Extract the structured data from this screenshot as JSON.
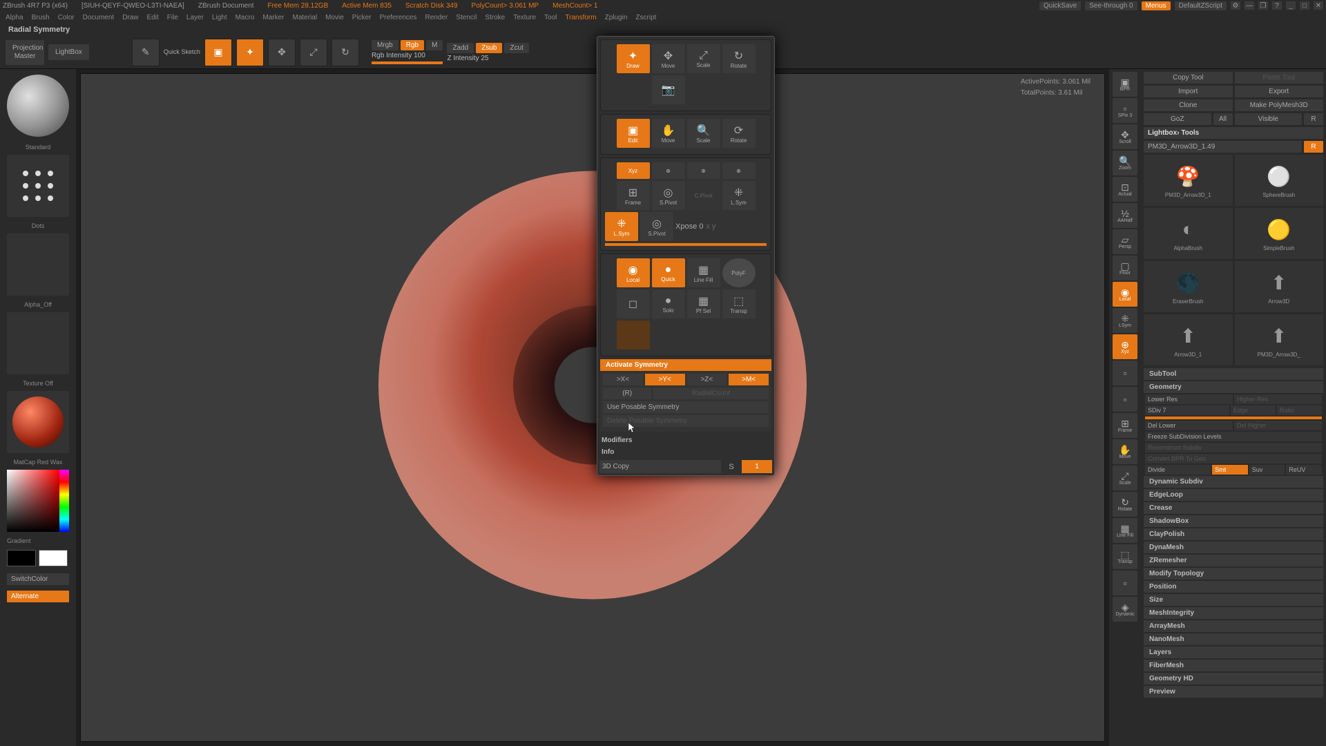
{
  "titlebar": {
    "app": "ZBrush 4R7 P3 (x64)",
    "session": "[SIUH-QEYF-QWEO-L3TI-NAEA]",
    "doc": "ZBrush Document",
    "free_mem": "Free Mem 28.12GB",
    "active_mem": "Active Mem 835",
    "scratch_disk": "Scratch Disk 349",
    "poly_count": "PolyCount> 3.061 MP",
    "mesh_count": "MeshCount> 1",
    "quicksave": "QuickSave",
    "see_through": "See-through 0",
    "menus": "Menus",
    "zscript": "DefaultZScript"
  },
  "menubar": {
    "items": [
      "Alpha",
      "Brush",
      "Color",
      "Document",
      "Draw",
      "Edit",
      "File",
      "Layer",
      "Light",
      "Macro",
      "Marker",
      "Material",
      "Movie",
      "Picker",
      "Preferences",
      "Render",
      "Stencil",
      "Stroke",
      "Texture",
      "Tool",
      "Transform",
      "Zplugin",
      "Zscript"
    ],
    "active": "Transform"
  },
  "status": "Radial Symmetry",
  "toolbar": {
    "projection_master": "Projection\nMaster",
    "lightbox": "LightBox",
    "quicksketch": "Quick\nSketch",
    "edit": "Edit",
    "draw": "Draw",
    "move": "Move",
    "scale": "Scale",
    "rotate": "Rotate",
    "mrgb": "Mrgb",
    "rgb": "Rgb",
    "m": "M",
    "rgb_intensity": "Rgb Intensity 100",
    "zadd": "Zadd",
    "zsub": "Zsub",
    "zcut": "Zcut",
    "z_intensity": "Z Intensity 25",
    "stats1": "ActivePoints: 3.061 Mil",
    "stats2": "TotalPoints: 3.61 Mil"
  },
  "left": {
    "brush_name": "Standard",
    "stroke_name": "Dots",
    "alpha_off": "Alpha_Off",
    "texture_off": "Texture Off",
    "material": "MatCap Red Wax",
    "gradient": "Gradient",
    "switchcolor": "SwitchColor",
    "alternate": "Alternate"
  },
  "shelf": {
    "items": [
      "BPR",
      "SPix 3",
      "Scroll",
      "Zoom",
      "Actual",
      "AAHalf",
      "Persp",
      "Floor",
      "Local",
      "LSym",
      "Xyz",
      "",
      "",
      "Frame",
      "Move",
      "Scale",
      "Rotate",
      "Line Fill",
      "Transp",
      "",
      "Dynamic"
    ],
    "active_indices": [
      8,
      10
    ]
  },
  "right": {
    "row1": {
      "copy_tool": "Copy Tool",
      "paste_tool": "Paste Tool"
    },
    "row2": {
      "import": "Import",
      "export": "Export"
    },
    "row3": {
      "clone": "Clone",
      "make": "Make PolyMesh3D"
    },
    "row4": {
      "goz": "GoZ",
      "all": "All",
      "visible": "Visible",
      "r": "R"
    },
    "lightbox_tools": "Lightbox› Tools",
    "current_tool": "PM3D_Arrow3D_1.49",
    "r_btn": "R",
    "tools": [
      "PM3D_Arrow3D_1",
      "SphereBrush",
      "AlphaBrush",
      "SimpleBrush",
      "EraserBrush",
      "Arrow3D",
      "Arrow3D_1",
      "PM3D_Arrow3D_"
    ],
    "accordions": [
      "SubTool",
      "Geometry",
      "Dynamic Subdiv",
      "EdgeLoop",
      "Crease",
      "ShadowBox",
      "ClayPolish",
      "DynaMesh",
      "ZRemesher",
      "Modify Topology",
      "Position",
      "Size",
      "MeshIntegrity",
      "ArrayMesh",
      "NanoMesh",
      "Layers",
      "FiberMesh",
      "Geometry HD",
      "Preview"
    ],
    "geom": {
      "lower_res": "Lower Res",
      "higher_res": "Higher Res",
      "sdiv": "SDiv 7",
      "edge": "Edge",
      "ratio": "Ratio",
      "del_lower": "Del Lower",
      "del_higher": "Del Higher",
      "freeze": "Freeze SubDivision Levels",
      "reconstruct": "Reconstruct Subdiv",
      "convert": "Convert BPR To Geo",
      "divide": "Divide",
      "smt": "Smt",
      "suv": "Suv",
      "reuv": "ReUV"
    }
  },
  "popup": {
    "draw": "Draw",
    "move": "Move",
    "scale": "Scale",
    "rotate": "Rotate",
    "edit": "Edit",
    "xyz": "Xyz",
    "frame": "Frame",
    "spivot": "S.Pivot",
    "cpivot": "C.Pivot",
    "lsym": "L.Sym",
    "lsym2": "L.Sym",
    "spivot2": "S.Pivot",
    "xpose": "Xpose 0",
    "xy": "x y",
    "local": "Local",
    "quick": "Quick",
    "line_fill": "Line Fill",
    "polyf": "PolyF",
    "solo": "Solo",
    "pf_sel": "Pf Sel",
    "transp": "Transp",
    "activate_sym": "Activate Symmetry",
    "sx": ">X<",
    "sy": ">Y<",
    "sz": ">Z<",
    "sm": ">M<",
    "r": "(R)",
    "radial_count": "RadialCount",
    "use_posable": "Use Posable Symmetry",
    "delete_posable": "Delete Posable Symmetry",
    "modifiers": "Modifiers",
    "info": "Info",
    "copy3d": "3D Copy",
    "copy_s": "S",
    "copy_val": "1"
  }
}
